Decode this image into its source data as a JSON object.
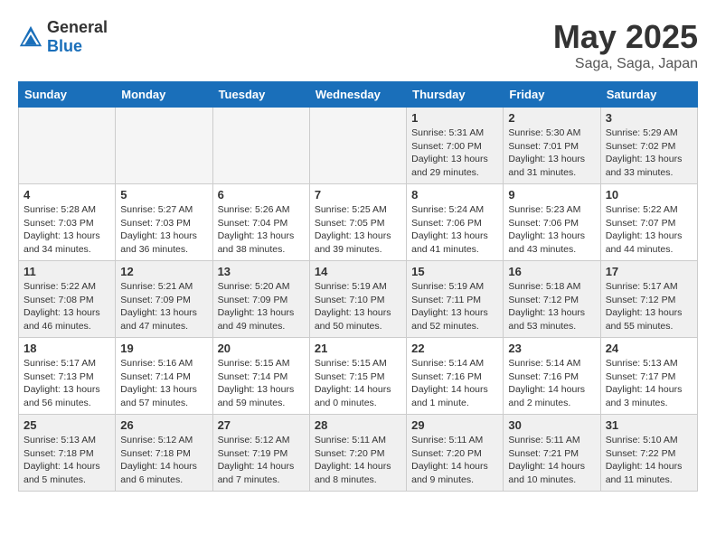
{
  "header": {
    "logo_general": "General",
    "logo_blue": "Blue",
    "month_title": "May 2025",
    "subtitle": "Saga, Saga, Japan"
  },
  "days_of_week": [
    "Sunday",
    "Monday",
    "Tuesday",
    "Wednesday",
    "Thursday",
    "Friday",
    "Saturday"
  ],
  "weeks": [
    [
      {
        "day": "",
        "info": ""
      },
      {
        "day": "",
        "info": ""
      },
      {
        "day": "",
        "info": ""
      },
      {
        "day": "",
        "info": ""
      },
      {
        "day": "1",
        "info": "Sunrise: 5:31 AM\nSunset: 7:00 PM\nDaylight: 13 hours\nand 29 minutes."
      },
      {
        "day": "2",
        "info": "Sunrise: 5:30 AM\nSunset: 7:01 PM\nDaylight: 13 hours\nand 31 minutes."
      },
      {
        "day": "3",
        "info": "Sunrise: 5:29 AM\nSunset: 7:02 PM\nDaylight: 13 hours\nand 33 minutes."
      }
    ],
    [
      {
        "day": "4",
        "info": "Sunrise: 5:28 AM\nSunset: 7:03 PM\nDaylight: 13 hours\nand 34 minutes."
      },
      {
        "day": "5",
        "info": "Sunrise: 5:27 AM\nSunset: 7:03 PM\nDaylight: 13 hours\nand 36 minutes."
      },
      {
        "day": "6",
        "info": "Sunrise: 5:26 AM\nSunset: 7:04 PM\nDaylight: 13 hours\nand 38 minutes."
      },
      {
        "day": "7",
        "info": "Sunrise: 5:25 AM\nSunset: 7:05 PM\nDaylight: 13 hours\nand 39 minutes."
      },
      {
        "day": "8",
        "info": "Sunrise: 5:24 AM\nSunset: 7:06 PM\nDaylight: 13 hours\nand 41 minutes."
      },
      {
        "day": "9",
        "info": "Sunrise: 5:23 AM\nSunset: 7:06 PM\nDaylight: 13 hours\nand 43 minutes."
      },
      {
        "day": "10",
        "info": "Sunrise: 5:22 AM\nSunset: 7:07 PM\nDaylight: 13 hours\nand 44 minutes."
      }
    ],
    [
      {
        "day": "11",
        "info": "Sunrise: 5:22 AM\nSunset: 7:08 PM\nDaylight: 13 hours\nand 46 minutes."
      },
      {
        "day": "12",
        "info": "Sunrise: 5:21 AM\nSunset: 7:09 PM\nDaylight: 13 hours\nand 47 minutes."
      },
      {
        "day": "13",
        "info": "Sunrise: 5:20 AM\nSunset: 7:09 PM\nDaylight: 13 hours\nand 49 minutes."
      },
      {
        "day": "14",
        "info": "Sunrise: 5:19 AM\nSunset: 7:10 PM\nDaylight: 13 hours\nand 50 minutes."
      },
      {
        "day": "15",
        "info": "Sunrise: 5:19 AM\nSunset: 7:11 PM\nDaylight: 13 hours\nand 52 minutes."
      },
      {
        "day": "16",
        "info": "Sunrise: 5:18 AM\nSunset: 7:12 PM\nDaylight: 13 hours\nand 53 minutes."
      },
      {
        "day": "17",
        "info": "Sunrise: 5:17 AM\nSunset: 7:12 PM\nDaylight: 13 hours\nand 55 minutes."
      }
    ],
    [
      {
        "day": "18",
        "info": "Sunrise: 5:17 AM\nSunset: 7:13 PM\nDaylight: 13 hours\nand 56 minutes."
      },
      {
        "day": "19",
        "info": "Sunrise: 5:16 AM\nSunset: 7:14 PM\nDaylight: 13 hours\nand 57 minutes."
      },
      {
        "day": "20",
        "info": "Sunrise: 5:15 AM\nSunset: 7:14 PM\nDaylight: 13 hours\nand 59 minutes."
      },
      {
        "day": "21",
        "info": "Sunrise: 5:15 AM\nSunset: 7:15 PM\nDaylight: 14 hours\nand 0 minutes."
      },
      {
        "day": "22",
        "info": "Sunrise: 5:14 AM\nSunset: 7:16 PM\nDaylight: 14 hours\nand 1 minute."
      },
      {
        "day": "23",
        "info": "Sunrise: 5:14 AM\nSunset: 7:16 PM\nDaylight: 14 hours\nand 2 minutes."
      },
      {
        "day": "24",
        "info": "Sunrise: 5:13 AM\nSunset: 7:17 PM\nDaylight: 14 hours\nand 3 minutes."
      }
    ],
    [
      {
        "day": "25",
        "info": "Sunrise: 5:13 AM\nSunset: 7:18 PM\nDaylight: 14 hours\nand 5 minutes."
      },
      {
        "day": "26",
        "info": "Sunrise: 5:12 AM\nSunset: 7:18 PM\nDaylight: 14 hours\nand 6 minutes."
      },
      {
        "day": "27",
        "info": "Sunrise: 5:12 AM\nSunset: 7:19 PM\nDaylight: 14 hours\nand 7 minutes."
      },
      {
        "day": "28",
        "info": "Sunrise: 5:11 AM\nSunset: 7:20 PM\nDaylight: 14 hours\nand 8 minutes."
      },
      {
        "day": "29",
        "info": "Sunrise: 5:11 AM\nSunset: 7:20 PM\nDaylight: 14 hours\nand 9 minutes."
      },
      {
        "day": "30",
        "info": "Sunrise: 5:11 AM\nSunset: 7:21 PM\nDaylight: 14 hours\nand 10 minutes."
      },
      {
        "day": "31",
        "info": "Sunrise: 5:10 AM\nSunset: 7:22 PM\nDaylight: 14 hours\nand 11 minutes."
      }
    ]
  ]
}
